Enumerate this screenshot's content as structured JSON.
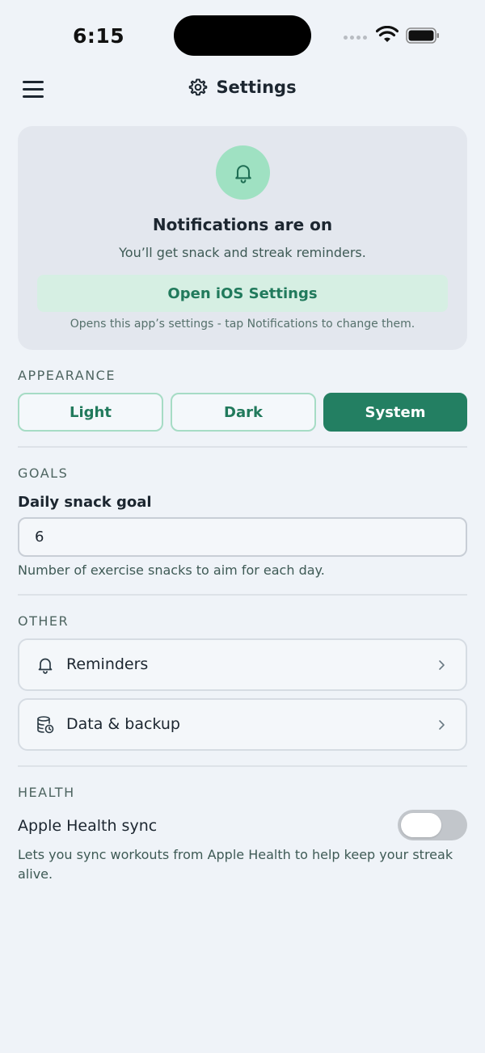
{
  "status_bar": {
    "time": "6:15"
  },
  "header": {
    "title": "Settings"
  },
  "notifications_card": {
    "title": "Notifications are on",
    "subtitle": "You’ll get snack and streak reminders.",
    "button_label": "Open iOS Settings",
    "note": "Opens this app’s settings - tap Notifications to change them."
  },
  "appearance": {
    "label": "APPEARANCE",
    "options": [
      "Light",
      "Dark",
      "System"
    ],
    "selected": "System"
  },
  "goals": {
    "label": "GOALS",
    "field_label": "Daily snack goal",
    "value": "6",
    "helper": "Number of exercise snacks to aim for each day."
  },
  "other": {
    "label": "OTHER",
    "items": [
      {
        "label": "Reminders",
        "icon": "bell-icon"
      },
      {
        "label": "Data & backup",
        "icon": "database-icon"
      }
    ]
  },
  "health": {
    "label": "HEALTH",
    "sync_label": "Apple Health sync",
    "enabled": false,
    "helper": "Lets you sync workouts from Apple Health to help keep your streak alive."
  },
  "colors": {
    "accent": "#237f62",
    "accent_light": "#d6efe3",
    "bell_circle": "#9fe1c2",
    "background": "#eff3f8"
  }
}
